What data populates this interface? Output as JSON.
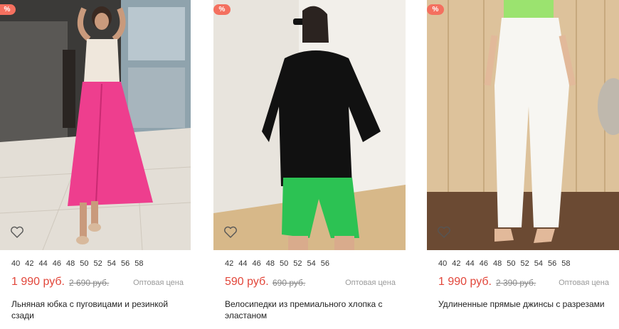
{
  "colors": {
    "accent": "#e2463a",
    "badge": "#f4705f",
    "muted": "#9a9a9a"
  },
  "products": [
    {
      "badge": "%",
      "sizes": [
        "40",
        "42",
        "44",
        "46",
        "48",
        "50",
        "52",
        "54",
        "56",
        "58"
      ],
      "price": "1 990 руб.",
      "old_price": "2 690 руб.",
      "wholesale": "Оптовая цена",
      "title": "Льняная юбка с пуговицами и резинкой сзади"
    },
    {
      "badge": "%",
      "sizes": [
        "42",
        "44",
        "46",
        "48",
        "50",
        "52",
        "54",
        "56"
      ],
      "price": "590 руб.",
      "old_price": "690 руб.",
      "wholesale": "Оптовая цена",
      "title": "Велосипедки из премиального хлопка с эластаном"
    },
    {
      "badge": "%",
      "sizes": [
        "40",
        "42",
        "44",
        "46",
        "48",
        "50",
        "52",
        "54",
        "56",
        "58"
      ],
      "price": "1 990 руб.",
      "old_price": "2 390 руб.",
      "wholesale": "Оптовая цена",
      "title": "Удлиненные прямые джинсы с разрезами"
    }
  ]
}
